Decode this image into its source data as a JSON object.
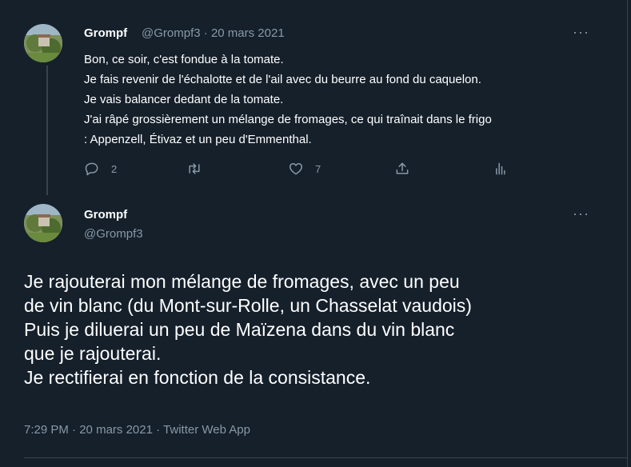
{
  "tweet1": {
    "name": "Grompf",
    "handle": "@Grompf3",
    "separator": "·",
    "date": "20 mars 2021",
    "more": "···",
    "lines": [
      "Bon, ce soir, c'est fondue à la tomate.",
      "Je fais revenir de l'échalotte et de l'ail avec du beurre au fond du caquelon.",
      "Je vais balancer dedant de la tomate.",
      "J'ai râpé grossièrement un mélange de fromages, ce qui traînait dans le frigo",
      ": Appenzell, Étivaz et un peu d'Emmenthal."
    ],
    "reply_count": "2",
    "like_count": "7"
  },
  "tweet2": {
    "name": "Grompf",
    "handle": "@Grompf3",
    "more": "···",
    "lines": [
      "Je rajouterai mon mélange de fromages, avec un peu",
      "de vin blanc (du Mont-sur-Rolle, un Chasselat vaudois)",
      "Puis je diluerai un peu de Maïzena dans du vin blanc",
      "que je rajouterai.",
      "Je rectifierai en fonction de la consistance."
    ],
    "time": "7:29 PM",
    "dot": "·",
    "date": "20 mars 2021",
    "source": "Twitter Web App"
  },
  "colors": {
    "background": "#15202b",
    "muted": "#8899a6",
    "border": "#38444d"
  },
  "icons": [
    "reply-icon",
    "retweet-icon",
    "like-icon",
    "share-icon",
    "analytics-icon",
    "more-icon"
  ]
}
